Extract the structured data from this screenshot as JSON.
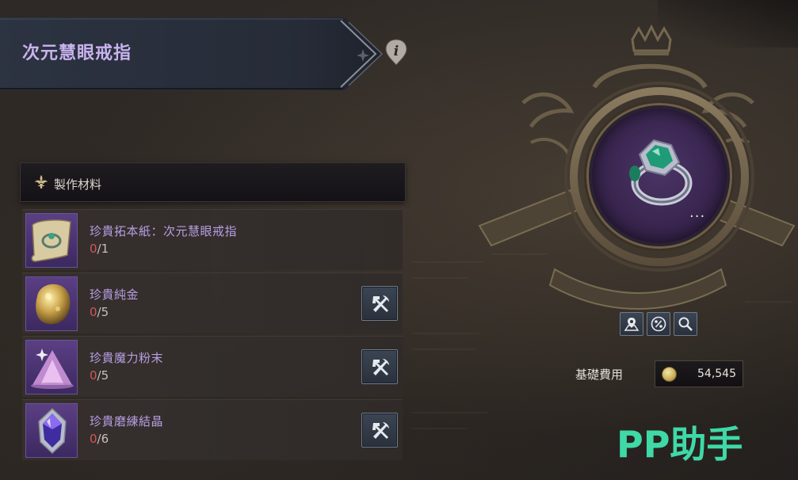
{
  "item": {
    "title": "次元慧眼戒指",
    "info_icon": "info-icon",
    "more_icon": "more-icon",
    "more_label": "..."
  },
  "materials": {
    "header_label": "製作材料",
    "header_icon": "fleur-de-lis-icon",
    "items": [
      {
        "name": "珍貴拓本紙：次元慧眼戒指",
        "have": "0",
        "need": "/1",
        "icon": "scroll-icon",
        "craftable": false
      },
      {
        "name": "珍貴純金",
        "have": "0",
        "need": "/5",
        "icon": "gold-ore-icon",
        "craftable": true
      },
      {
        "name": "珍貴魔力粉末",
        "have": "0",
        "need": "/5",
        "icon": "magic-powder-icon",
        "craftable": true
      },
      {
        "name": "珍貴磨練結晶",
        "have": "0",
        "need": "/6",
        "icon": "crystal-icon",
        "craftable": true
      }
    ],
    "craft_icon": "hammer-pickaxe-icon"
  },
  "tools": [
    {
      "icon": "map-icon"
    },
    {
      "icon": "percent-icon"
    },
    {
      "icon": "magnifier-icon"
    }
  ],
  "cost": {
    "label": "基礎費用",
    "value": "54,545",
    "icon": "gold-coin-icon"
  },
  "watermark": {
    "text": "PP助手"
  },
  "colors": {
    "title": "#c9b3ee",
    "material_name": "#b79fe3",
    "missing_count": "#d05858",
    "watermark": "#3fd9a8"
  }
}
